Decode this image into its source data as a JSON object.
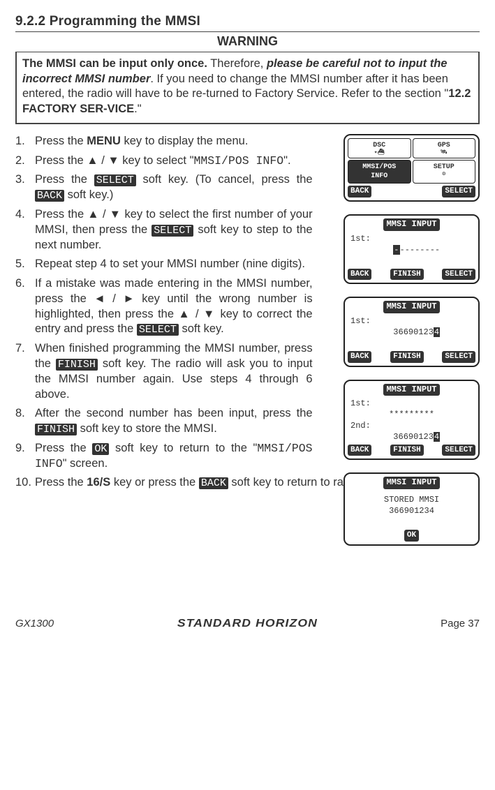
{
  "section_title": "9.2.2  Programming the MMSI",
  "warning_label": "WARNING",
  "warning_parts": {
    "a": "The MMSI can be input only once.",
    "b": " Therefore, ",
    "c": "please be careful not to input the incorrect MMSI number",
    "d": ". If you need to change the MMSI number after it has been entered, the radio will have to be re-turned to Factory Service. Refer to the section \"",
    "e": "12.2 FACTORY SER-VICE",
    "f": ".\""
  },
  "steps": {
    "s1a": "1.",
    "s1b_pre": "Press the ",
    "s1b_bold": "MENU",
    "s1b_post": " key to display the menu.",
    "s2a": "2.",
    "s2b_pre": "Press the ▲ / ▼ key to select \"",
    "s2b_mono": "MMSI/POS INFO",
    "s2b_post": "\".",
    "s3a": "3.",
    "s3b_pre": "Press the ",
    "s3b_inv1": "SELECT",
    "s3b_mid": " soft key. (To cancel, press the ",
    "s3b_inv2": "BACK",
    "s3b_post": " soft key.)",
    "s4a": "4.",
    "s4b_pre": "Press the ▲ / ▼ key to select the first number of your MMSI, then press the ",
    "s4b_inv": "SELECT",
    "s4b_post": " soft key to step to the next number.",
    "s5a": "5.",
    "s5b": "Repeat step 4 to set your MMSI number (nine digits).",
    "s6a": "6.",
    "s6b_pre": "If a mistake was made entering in the MMSI number, press the ◄ / ► key until the wrong number is highlighted, then press the ▲ / ▼ key to correct the entry and press the ",
    "s6b_inv": "SELECT",
    "s6b_post": " soft key.",
    "s7a": "7.",
    "s7b_pre": "When finished programming the MMSI number, press the ",
    "s7b_inv": "FINISH",
    "s7b_post": " soft key. The radio will ask you to input the MMSI number again. Use steps 4 through 6 above.",
    "s8a": "8.",
    "s8b_pre": "After the second number has been input, press the ",
    "s8b_inv": "FINISH",
    "s8b_post": " soft key to store the MMSI.",
    "s9a": "9.",
    "s9b_pre": "Press the ",
    "s9b_inv": "OK",
    "s9b_mid": " soft key to return to the \"",
    "s9b_mono": "MMSI/POS INFO",
    "s9b_post": "\" screen.",
    "s10a": "10.",
    "s10b_pre": "Press the ",
    "s10b_bold": "16/S",
    "s10b_mid": " key or press the ",
    "s10b_inv": "BACK",
    "s10b_post": " soft key to return to radio opera-tion mode."
  },
  "menu": {
    "dsc": "DSC",
    "gps": "GPS",
    "mmsi": "MMSI/POS",
    "mmsi2": "INFO",
    "setup": "SETUP",
    "back": "BACK",
    "select": "SELECT"
  },
  "lcd": {
    "title": "MMSI INPUT",
    "first": "1st:",
    "dashes": "--------",
    "cursor": "-",
    "value1": "36690123",
    "last4": "4",
    "stars": "*********",
    "second": "2nd:",
    "value2a": "36690123",
    "value2b": "4",
    "stored": "STORED MMSI",
    "stored_num": "366901234",
    "back": "BACK",
    "finish": "FINISH",
    "select": "SELECT",
    "ok": "OK"
  },
  "footer": {
    "model": "GX1300",
    "brand": "STANDARD HORIZON",
    "page": "Page 37"
  }
}
